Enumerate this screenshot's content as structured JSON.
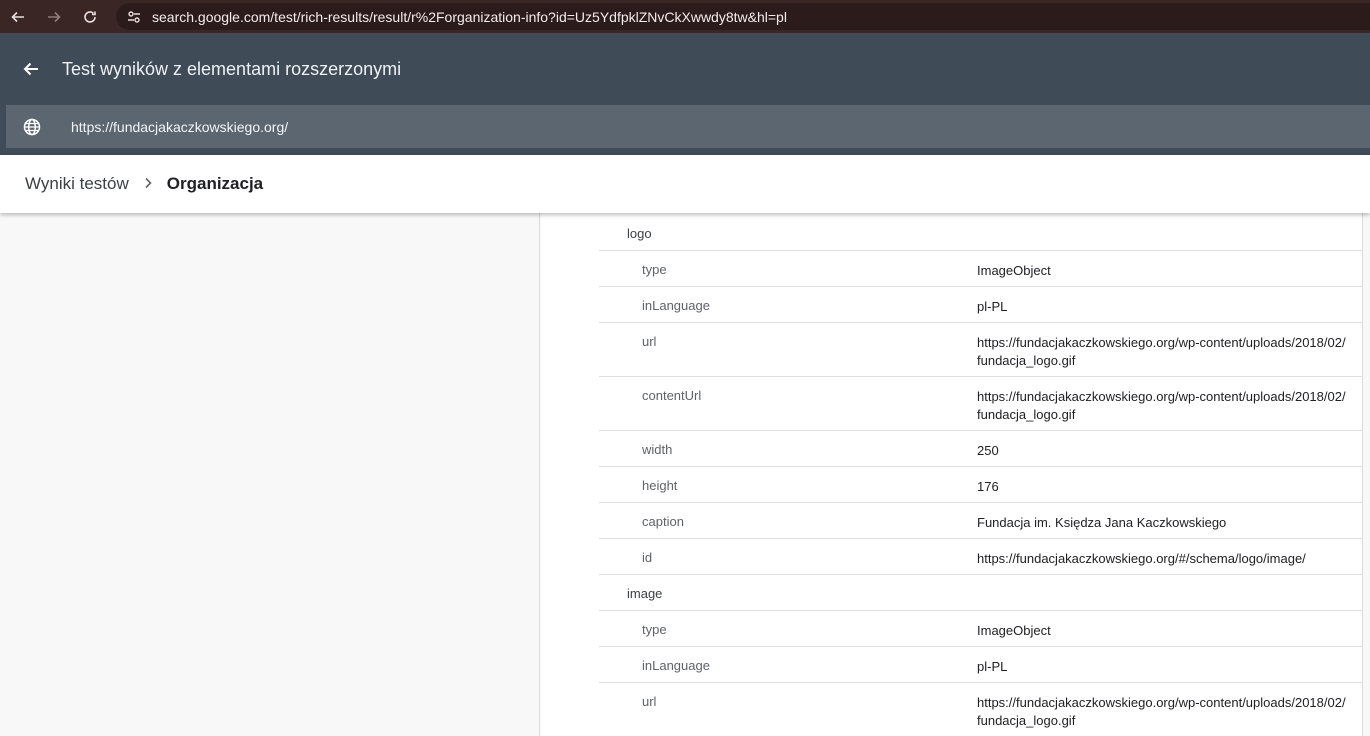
{
  "browser": {
    "url": "search.google.com/test/rich-results/result/r%2Forganization-info?id=Uz5YdfpklZNvCkXwwdy8tw&hl=pl",
    "icons": [
      "back-arrow-icon",
      "forward-arrow-icon",
      "reload-icon",
      "site-settings-icon"
    ]
  },
  "app": {
    "title": "Test wyników z elementami rozszerzonymi",
    "tested_url": "https://fundacjakaczkowskiego.org/"
  },
  "breadcrumb": {
    "items": [
      "Wyniki testów",
      "Organizacja"
    ]
  },
  "details": {
    "logo_label": "logo",
    "logo": [
      {
        "key": "type",
        "value": "ImageObject"
      },
      {
        "key": "inLanguage",
        "value": "pl-PL"
      },
      {
        "key": "url",
        "value": "https://fundacjakaczkowskiego.org/wp-content/uploads/2018/02/fundacja_logo.gif"
      },
      {
        "key": "contentUrl",
        "value": "https://fundacjakaczkowskiego.org/wp-content/uploads/2018/02/fundacja_logo.gif"
      },
      {
        "key": "width",
        "value": "250"
      },
      {
        "key": "height",
        "value": "176"
      },
      {
        "key": "caption",
        "value": "Fundacja im. Księdza Jana Kaczkowskiego"
      },
      {
        "key": "id",
        "value": "https://fundacjakaczkowskiego.org/#/schema/logo/image/"
      }
    ],
    "image_label": "image",
    "image": [
      {
        "key": "type",
        "value": "ImageObject"
      },
      {
        "key": "inLanguage",
        "value": "pl-PL"
      },
      {
        "key": "url",
        "value": "https://fundacjakaczkowskiego.org/wp-content/uploads/2018/02/fundacja_logo.gif"
      }
    ]
  }
}
